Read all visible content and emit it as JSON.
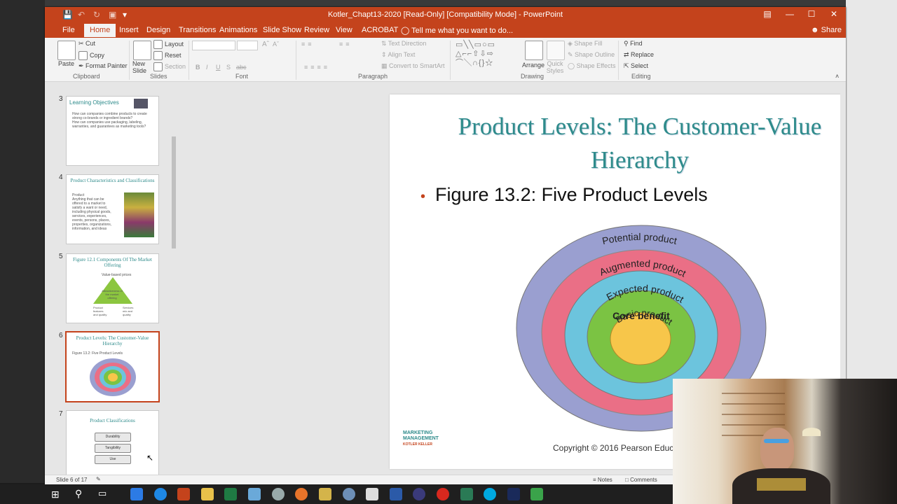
{
  "window": {
    "title": "Kotler_Chapt13-2020 [Read-Only] [Compatibility Mode] - PowerPoint"
  },
  "tabs": [
    "File",
    "Home",
    "Insert",
    "Design",
    "Transitions",
    "Animations",
    "Slide Show",
    "Review",
    "View",
    "ACROBAT"
  ],
  "tell_me": "Tell me what you want to do...",
  "share": "Share",
  "ribbon": {
    "clipboard": {
      "paste": "Paste",
      "cut": "Cut",
      "copy": "Copy",
      "format_painter": "Format Painter",
      "label": "Clipboard"
    },
    "slides": {
      "new_slide": "New Slide",
      "layout": "Layout",
      "reset": "Reset",
      "section": "Section",
      "label": "Slides"
    },
    "font": {
      "label": "Font",
      "bold": "B",
      "italic": "I",
      "underline": "U",
      "shadow": "S",
      "strike": "abc"
    },
    "paragraph": {
      "text_direction": "Text Direction",
      "align_text": "Align Text",
      "smartart": "Convert to SmartArt",
      "label": "Paragraph"
    },
    "drawing": {
      "arrange": "Arrange",
      "quick_styles": "Quick Styles",
      "shape_fill": "Shape Fill",
      "shape_outline": "Shape Outline",
      "shape_effects": "Shape Effects",
      "label": "Drawing"
    },
    "editing": {
      "find": "Find",
      "replace": "Replace",
      "select": "Select",
      "label": "Editing"
    }
  },
  "thumbnails": [
    {
      "num": "3",
      "title": "Learning Objectives",
      "lines": [
        "How can companies combine products to create",
        "strong co-brands or ingredient brands?",
        "How can companies use packaging, labeling,",
        "warranties, and guarantees as marketing tools?"
      ]
    },
    {
      "num": "4",
      "title": "Product Characteristics and Classifications",
      "lines": [
        "Product",
        "Anything that can be",
        "offered to a market to",
        "satisfy a want or need,",
        "including physical goods,",
        "services, experiences,",
        "events, persons, places,",
        "properties, organizations,",
        "information, and ideas"
      ]
    },
    {
      "num": "5",
      "title": "Figure 12.1 Components Of The Market Offering",
      "lines": [
        "Value-based prices",
        "Attractiveness of the market offering",
        "Product features and quality",
        "Services mix and quality"
      ]
    },
    {
      "num": "6",
      "title": "Product Levels: The Customer-Value Hierarchy",
      "lines": [
        "Figure 13.2: Five Product Levels"
      ]
    },
    {
      "num": "7",
      "title": "Product Classifications",
      "lines": [
        "Durability",
        "Tangibility",
        "Use"
      ]
    }
  ],
  "slide": {
    "title": "Product Levels: The Customer-Value Hierarchy",
    "bullet": "Figure 13.2: Five Product Levels",
    "levels": [
      "Potential product",
      "Augmented product",
      "Expected product",
      "Basic product",
      "Core benefit"
    ],
    "colors": {
      "potential": "#9a9fd0",
      "augmented": "#ea6f86",
      "expected": "#6cc4dd",
      "basic": "#7bc343",
      "core": "#f7c64a"
    },
    "copyright": "Copyright © 2016 Pearson Education, Inc.",
    "logo": [
      "MARKETING",
      "MANAGEMENT",
      "KOTLER KELLER"
    ]
  },
  "status": {
    "slide_of": "Slide 6 of 17",
    "notes": "Notes",
    "comments": "Comments"
  },
  "accent": "#c4431c"
}
